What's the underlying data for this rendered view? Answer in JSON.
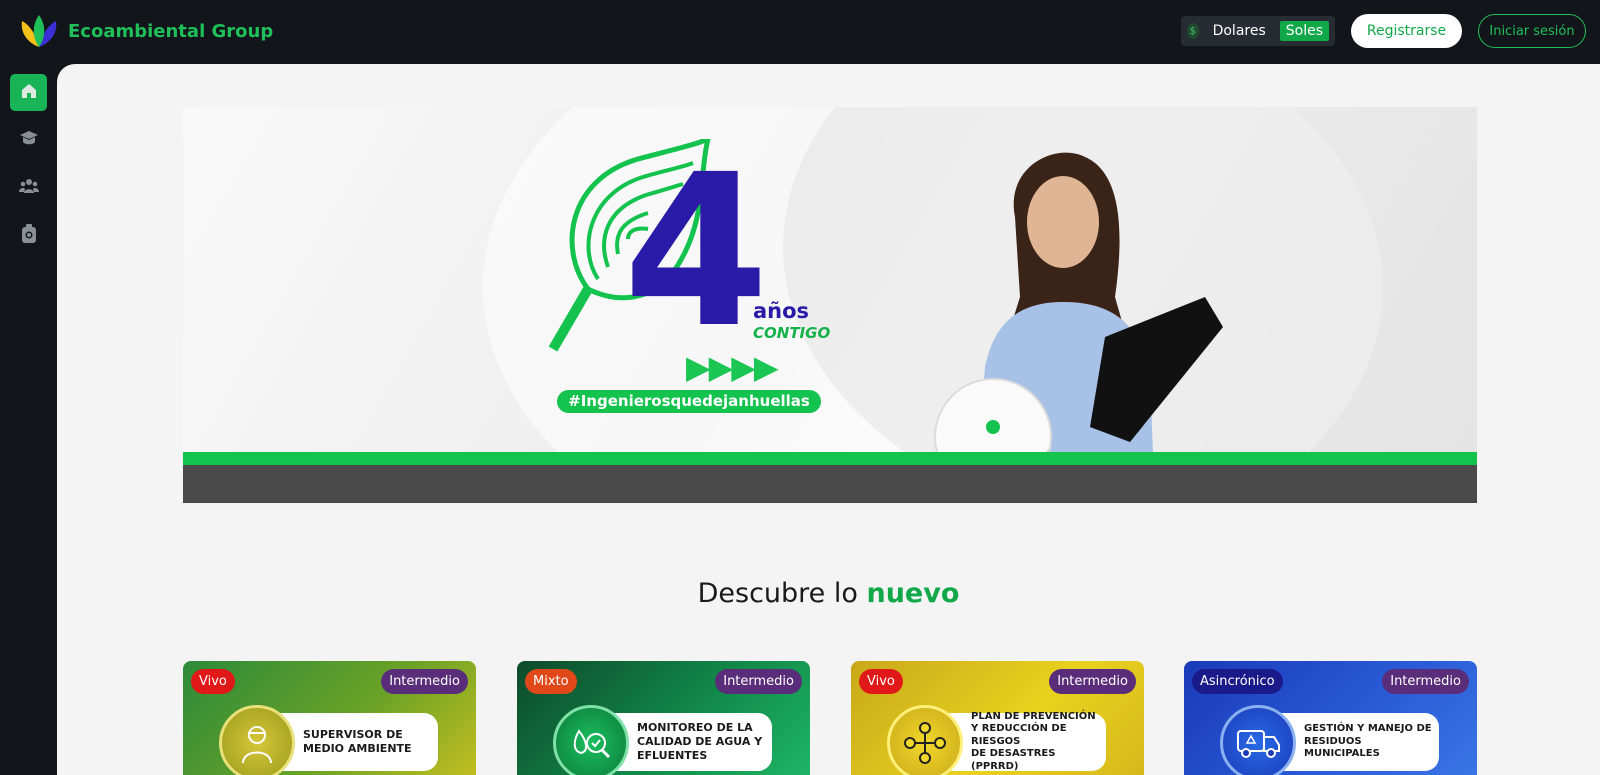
{
  "brand": {
    "name": "Ecoambiental Group"
  },
  "currency": {
    "option_dolares": "Dolares",
    "option_soles": "Soles",
    "selected": "Soles"
  },
  "auth": {
    "register_label": "Registrarse",
    "login_label": "Iniciar sesión"
  },
  "sidebar": {
    "items": [
      {
        "icon": "home-icon",
        "active": true
      },
      {
        "icon": "graduation-cap-icon",
        "active": false
      },
      {
        "icon": "group-icon",
        "active": false
      },
      {
        "icon": "badge-icon",
        "active": false
      }
    ]
  },
  "banner": {
    "number": "4",
    "anos": "años",
    "contigo": "CONTIGO",
    "hashtag": "#Ingenierosquedejanhuellas",
    "arrows": "▶▶▶▶"
  },
  "section": {
    "title_prefix": "Descubre lo",
    "title_accent": "nuevo"
  },
  "courses": [
    {
      "mode": "Vivo",
      "level": "Intermedio",
      "title": "SUPERVISOR DE\nMEDIO AMBIENTE"
    },
    {
      "mode": "Mixto",
      "level": "Intermedio",
      "title": "MONITOREO DE LA\nCALIDAD DE AGUA Y\nEFLUENTES"
    },
    {
      "mode": "Vivo",
      "level": "Intermedio",
      "title": "PLAN DE PREVENCIÓN\nY REDUCCIÓN DE RIESGOS\nDE DESASTRES (PPRRD)"
    },
    {
      "mode": "Asincrónico",
      "level": "Intermedio",
      "title": "GESTIÓN Y MANEJO DE\nRESIDUOS MUNICIPALES"
    }
  ],
  "colors": {
    "brand_green": "#1fbf5a",
    "banner_blue": "#2a1aa8",
    "badge_live": "#e01818",
    "badge_mixed": "#e0481a",
    "badge_async": "#1a1a8a",
    "badge_level": "#5a2d7a"
  }
}
